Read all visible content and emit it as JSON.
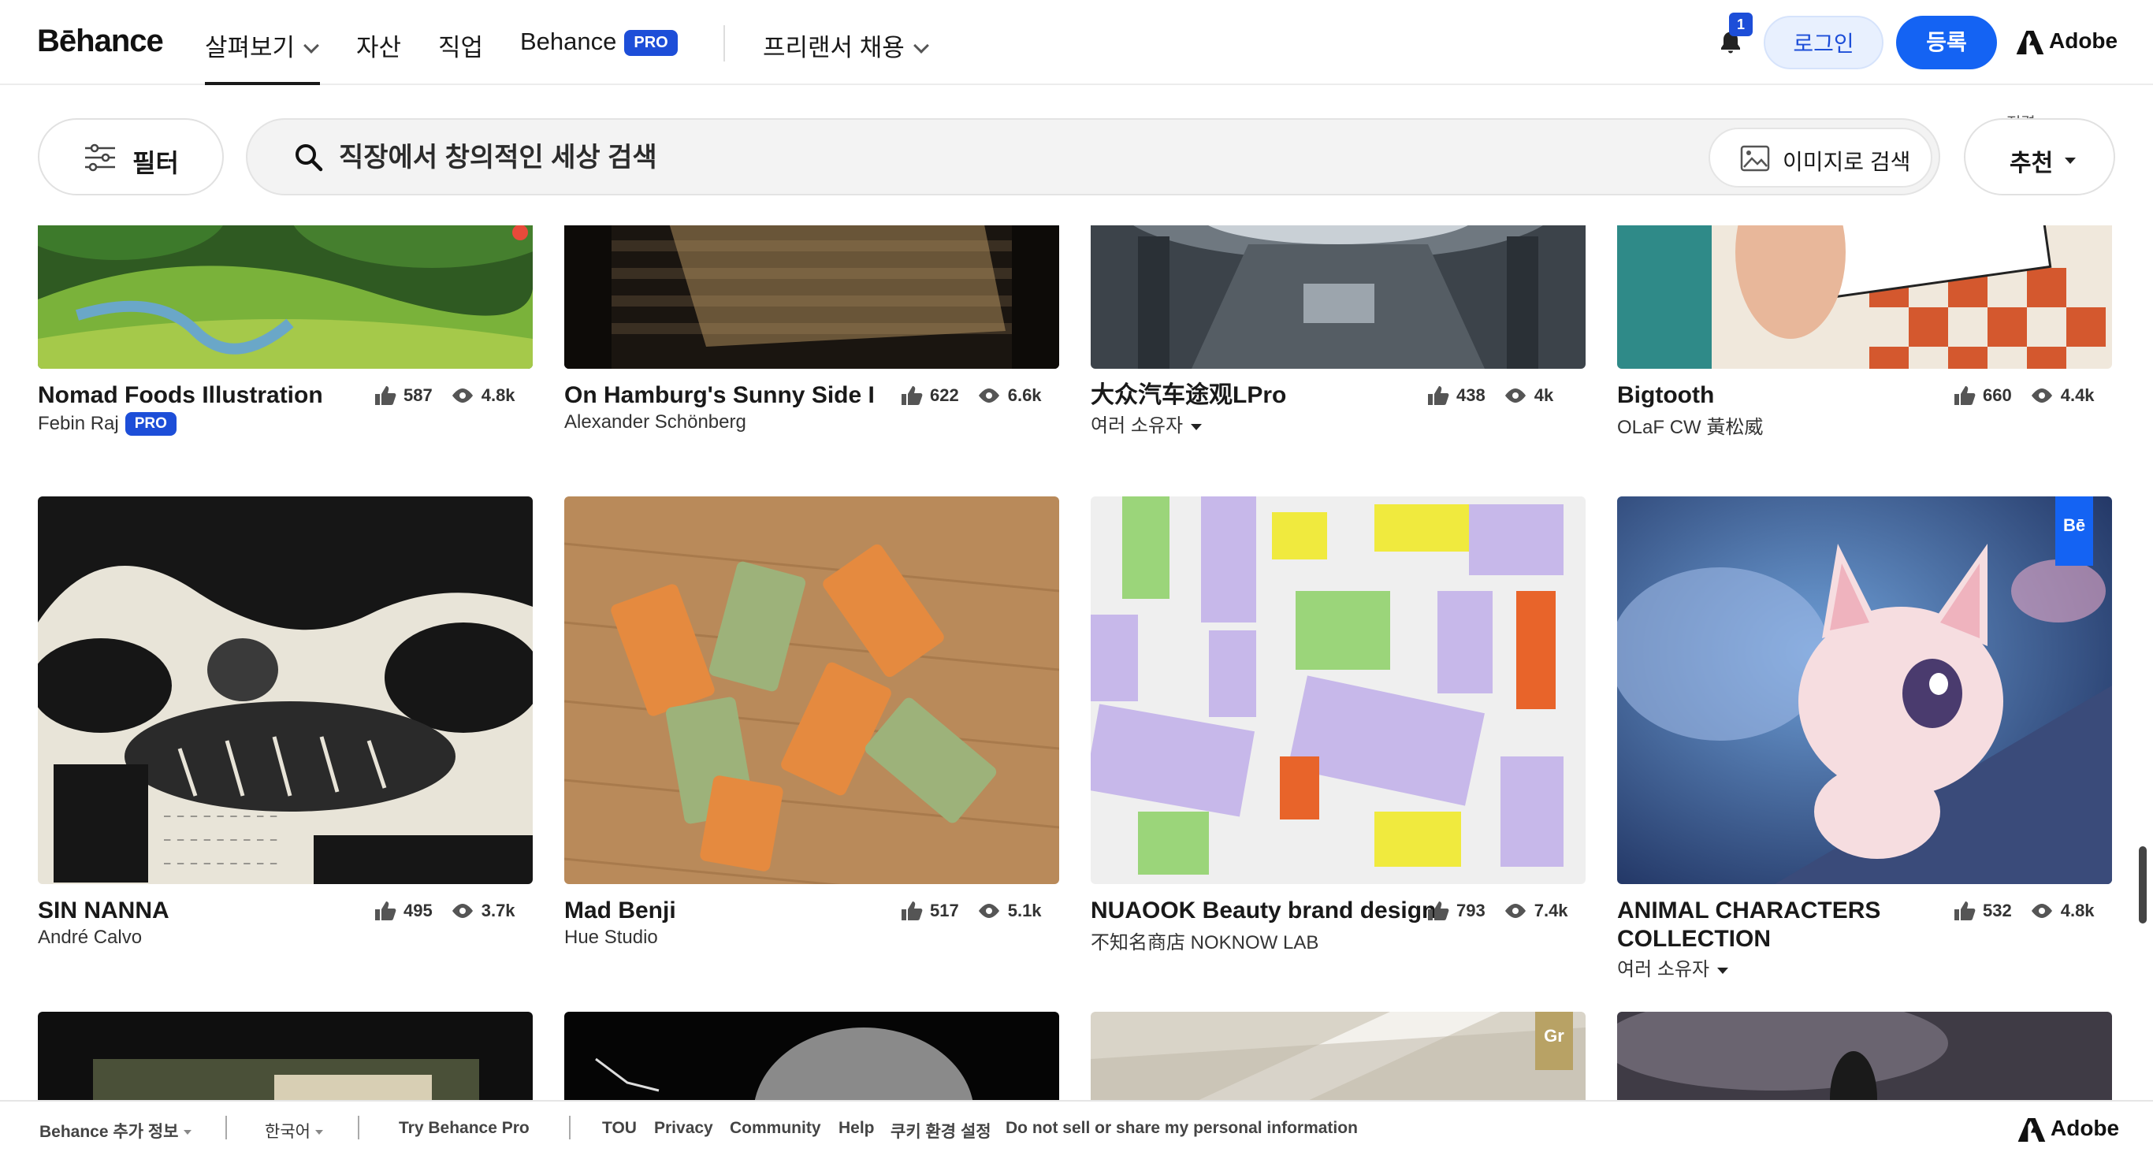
{
  "nav": {
    "logo": "Bēhance",
    "explore": "살펴보기",
    "assets": "자산",
    "jobs": "직업",
    "behance_pro": "Behance",
    "pro_badge": "PRO",
    "hire": "프리랜서 채용",
    "notification_count": "1",
    "login": "로그인",
    "signup": "등록",
    "adobe": "Adobe"
  },
  "search": {
    "filter_label": "필터",
    "placeholder": "직장에서 창의적인 세상 검색",
    "image_search": "이미지로 검색",
    "sort_caption": "정렬",
    "sort_value": "추천"
  },
  "projects": [
    {
      "title": "Nomad Foods Illustration",
      "owner": "Febin Raj",
      "owner_pro": "PRO",
      "likes": "587",
      "views": "4.8k"
    },
    {
      "title": "On Hamburg's Sunny Side I",
      "owner": "Alexander Schönberg",
      "likes": "622",
      "views": "6.6k"
    },
    {
      "title": "大众汽车途观LPro",
      "owner": "여러 소유자",
      "likes": "438",
      "views": "4k"
    },
    {
      "title": "Bigtooth",
      "owner": "OLaF CW 黃松威",
      "likes": "660",
      "views": "4.4k"
    },
    {
      "title": "SIN NANNA",
      "owner": "André Calvo",
      "likes": "495",
      "views": "3.7k"
    },
    {
      "title": "Mad Benji",
      "owner": "Hue Studio",
      "likes": "517",
      "views": "5.1k"
    },
    {
      "title": "NUAOOK Beauty brand design",
      "owner": "不知名商店 NOKNOW LAB",
      "likes": "793",
      "views": "7.4k"
    },
    {
      "title": "ANIMAL CHARACTERS COLLECTION",
      "owner": "여러 소유자",
      "likes": "532",
      "views": "4.8k"
    }
  ],
  "badges": {
    "be": "Bē",
    "gr": "Gr"
  },
  "footer": {
    "more_info": "Behance 추가 정보",
    "language": "한국어",
    "try_pro": "Try Behance Pro",
    "tou": "TOU",
    "privacy": "Privacy",
    "community": "Community",
    "help": "Help",
    "cookie": "쿠키 환경 설정",
    "do_not_sell": "Do not sell or share my personal information",
    "adobe": "Adobe"
  },
  "colors": {
    "accent": "#1463f3",
    "pro": "#1d4ed8"
  }
}
